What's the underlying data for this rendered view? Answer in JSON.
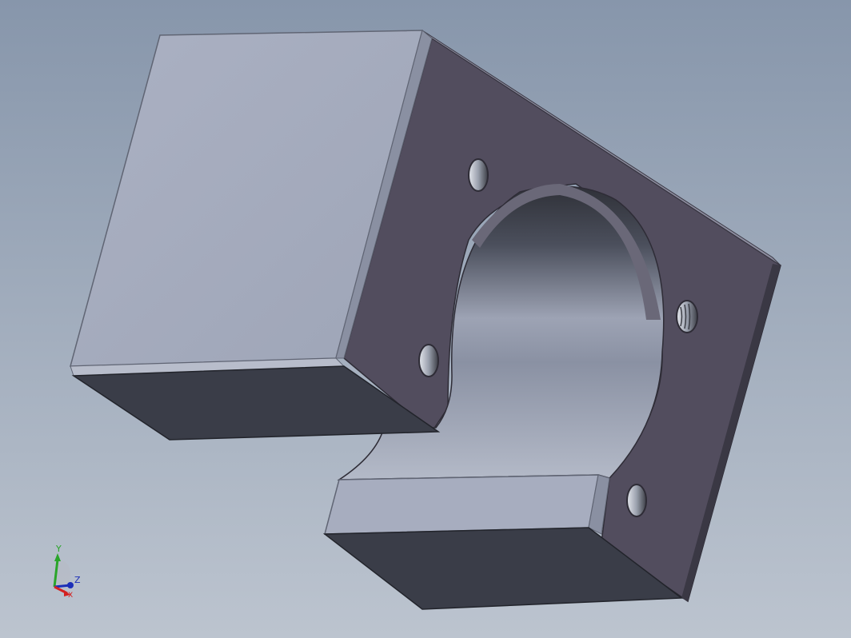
{
  "viewport": {
    "background_top": "#8796ab",
    "background_bottom": "#bcc4cf"
  },
  "model": {
    "type": "motor-mount-bracket",
    "faces": {
      "flange": "#524d5e",
      "top": "#a6acbe",
      "bottom": "#3a3d48",
      "bore": "#8a91a3"
    }
  },
  "triad": {
    "y_label": "Y",
    "z_label": "Z",
    "x_label": "X",
    "y_color": "#2aa52a",
    "z_color": "#1c2fb8",
    "x_color": "#d42020"
  }
}
